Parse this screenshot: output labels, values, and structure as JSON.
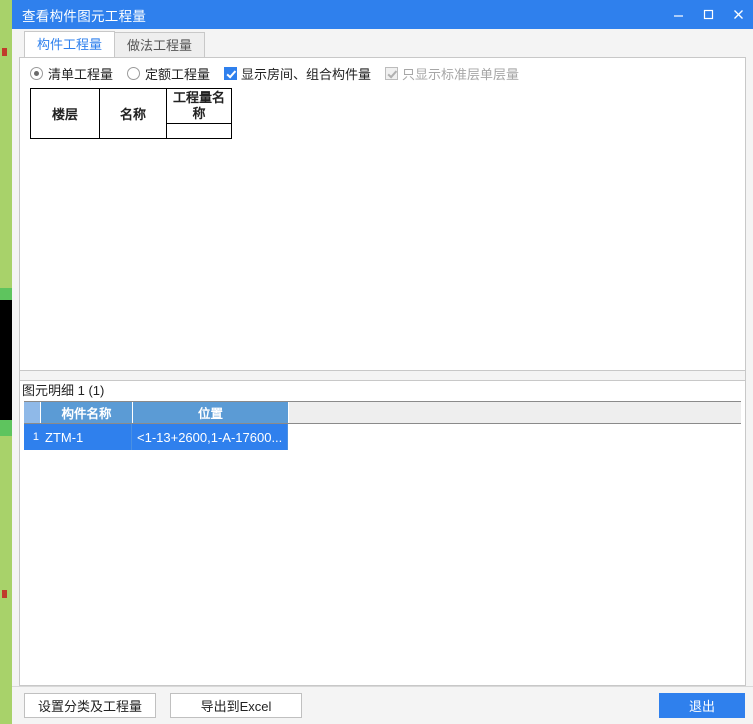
{
  "window": {
    "title": "查看构件图元工程量",
    "controls": {
      "minimize": "—",
      "maximize": "❐",
      "close": "✕"
    }
  },
  "tabs": [
    {
      "label": "构件工程量",
      "active": true
    },
    {
      "label": "做法工程量",
      "active": false
    }
  ],
  "options": {
    "radios": [
      {
        "label": "清单工程量",
        "checked": true
      },
      {
        "label": "定额工程量",
        "checked": false
      }
    ],
    "checkboxes": [
      {
        "label": "显示房间、组合构件量",
        "checked": true,
        "disabled": false
      },
      {
        "label": "只显示标准层单层量",
        "checked": true,
        "disabled": true
      }
    ]
  },
  "quantity_table": {
    "headers": [
      "楼层",
      "名称",
      "工程量名称"
    ],
    "sub_header": "",
    "rows": []
  },
  "detail": {
    "caption": "图元明细  1 (1)",
    "columns": [
      "构件名称",
      "位置"
    ],
    "rows": [
      {
        "index": "1",
        "name": "ZTM-1",
        "position": "<1-13+2600,1-A-17600..."
      }
    ]
  },
  "footer": {
    "set_category_button": "设置分类及工程量",
    "export_excel_button": "导出到Excel",
    "exit_button": "退出"
  },
  "colors": {
    "title_bar": "#2f80ed",
    "accent": "#2f80ed",
    "grid_header": "#5b9bd5",
    "selection": "#2f80ed",
    "desktop_green": "#a8d26a"
  }
}
